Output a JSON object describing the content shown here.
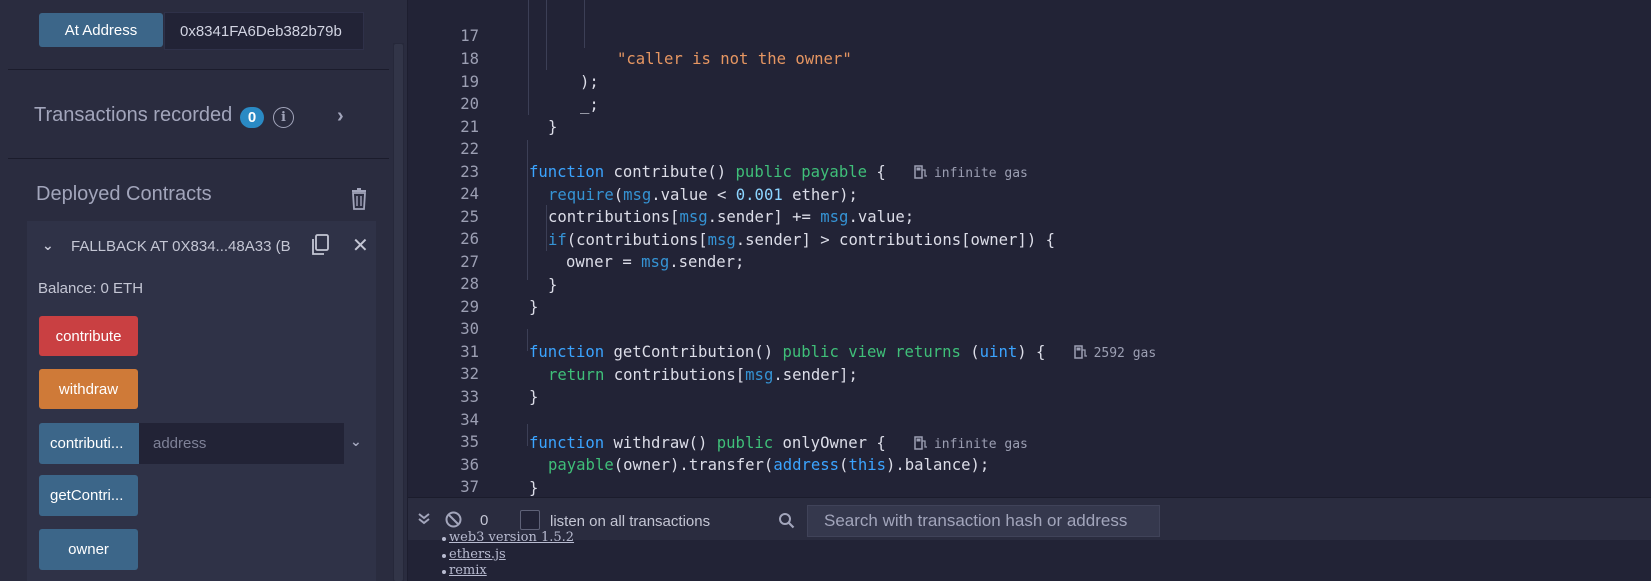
{
  "run_panel": {
    "at_address_label": "At Address",
    "at_address_value": "0x8341FA6Deb382b79b",
    "transactions_recorded_label": "Transactions recorded",
    "transactions_count": "0",
    "deployed_contracts_label": "Deployed Contracts",
    "contract": {
      "name": "FALLBACK AT 0X834...48A33 (B",
      "balance": "Balance: 0 ETH",
      "functions": [
        {
          "label": "contribute",
          "color": "#c94042"
        },
        {
          "label": "withdraw",
          "color": "#cf7a38"
        },
        {
          "label": "contributi...",
          "color": "#3c6689",
          "input_placeholder": "address"
        },
        {
          "label": "getContri...",
          "color": "#3c6689"
        },
        {
          "label": "owner",
          "color": "#3c6689"
        }
      ]
    }
  },
  "editor": {
    "line_numbers": [
      "17",
      "18",
      "19",
      "20",
      "21",
      "22",
      "23",
      "24",
      "25",
      "26",
      "27",
      "28",
      "29",
      "30",
      "31",
      "32",
      "33",
      "34",
      "35",
      "36",
      "37"
    ],
    "lines": {
      "l17_str": "\"caller is not the owner\"",
      "l18": ");",
      "l19": "_;",
      "l20": "}",
      "l22_fn": "function",
      "l22_name": " contribute() ",
      "l22_mods": "public payable",
      "l22_end": " {",
      "l22_gas": "infinite gas",
      "l23_req": "require",
      "l23_a": "(",
      "l23_msg": "msg",
      "l23_b": ".value < ",
      "l23_num": "0.001",
      "l23_c": " ether);",
      "l24_a": "contributions[",
      "l24_msg1": "msg",
      "l24_b": ".sender] += ",
      "l24_msg2": "msg",
      "l24_c": ".value;",
      "l25_if": "if",
      "l25_a": "(contributions[",
      "l25_msg": "msg",
      "l25_b": ".sender] > contributions[owner]) {",
      "l26_a": "owner = ",
      "l26_msg": "msg",
      "l26_b": ".sender;",
      "l27": "}",
      "l28": "}",
      "l30_fn": "function",
      "l30_name": " getContribution() ",
      "l30_mods": "public view returns",
      "l30_a": " (",
      "l30_type": "uint",
      "l30_b": ") {",
      "l30_gas": "2592 gas",
      "l31_ret": "return",
      "l31_a": " contributions[",
      "l31_msg": "msg",
      "l31_b": ".sender];",
      "l32": "}",
      "l34_fn": "function",
      "l34_name": " withdraw() ",
      "l34_pub": "public",
      "l34_b": " onlyOwner {",
      "l34_gas": "infinite gas",
      "l35_pay": "payable",
      "l35_a": "(owner).transfer(",
      "l35_addr": "address",
      "l35_b": "(",
      "l35_this": "this",
      "l35_c": ").balance);",
      "l36": "}"
    }
  },
  "terminal": {
    "pending_count": "0",
    "listen_label": "listen on all transactions",
    "search_placeholder": "Search with transaction hash or address",
    "links": [
      "web3 version 1.5.2",
      "ethers.js",
      "remix"
    ]
  },
  "colors": {
    "keyword": "#3ba4ff",
    "modifier": "#3fbf79",
    "string": "#e69662",
    "msg": "#3593d4",
    "badge": "#2a8ac4"
  }
}
